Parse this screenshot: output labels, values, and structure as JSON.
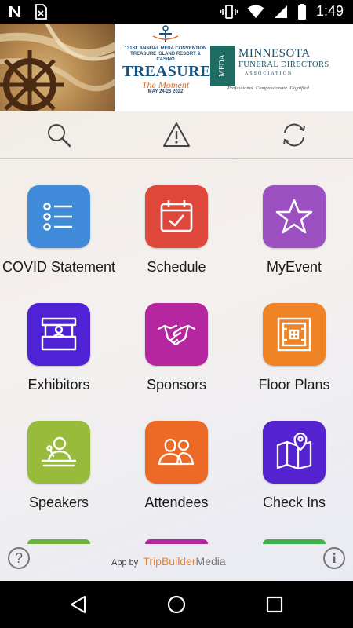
{
  "status_bar": {
    "time": "1:49",
    "left_icons": [
      "n-icon",
      "sim-x-icon"
    ],
    "right_icons": [
      "vibrate-icon",
      "wifi-icon",
      "signal-icon",
      "battery-icon"
    ]
  },
  "banner": {
    "convention_line1": "131ST ANNUAL MFDA CONVENTION",
    "convention_line2": "TREASURE ISLAND RESORT & CASINO",
    "event_title": "TREASURE",
    "event_subtitle": "The Moment",
    "dates": "MAY 24-26 2022",
    "org_line1": "MINNESOTA",
    "org_line2": "FUNERAL DIRECTORS",
    "org_line3": "ASSOCIATION",
    "badge_text": "MFDA",
    "tagline": "Professional. Compassionate. Dignified."
  },
  "toolbar": {
    "icons": [
      "search-icon",
      "alert-icon",
      "sync-icon"
    ]
  },
  "tiles": [
    {
      "label": "COVID Statement",
      "color": "#3f8bd9",
      "icon": "list-icon"
    },
    {
      "label": "Schedule",
      "color": "#e0473b",
      "icon": "calendar-check-icon"
    },
    {
      "label": "MyEvent",
      "color": "#9b4fc0",
      "icon": "star-icon"
    },
    {
      "label": "Exhibitors",
      "color": "#4f22d6",
      "icon": "booth-icon"
    },
    {
      "label": "Sponsors",
      "color": "#b4279f",
      "icon": "handshake-icon"
    },
    {
      "label": "Floor Plans",
      "color": "#ee8425",
      "icon": "floor-plan-icon"
    },
    {
      "label": "Speakers",
      "color": "#98bb3b",
      "icon": "speaker-icon"
    },
    {
      "label": "Attendees",
      "color": "#ec6a25",
      "icon": "people-icon"
    },
    {
      "label": "Check Ins",
      "color": "#5522cf",
      "icon": "map-pin-icon"
    }
  ],
  "peek_colors": [
    "#6cb23b",
    "#b4279f",
    "#3fb04b"
  ],
  "footer": {
    "app_by": "App by",
    "brand_a": "TripBuilder",
    "brand_b": "Media",
    "help_glyph": "?",
    "info_glyph": "i"
  },
  "navbar": {
    "icons": [
      "back-icon",
      "home-icon",
      "recents-icon"
    ]
  }
}
